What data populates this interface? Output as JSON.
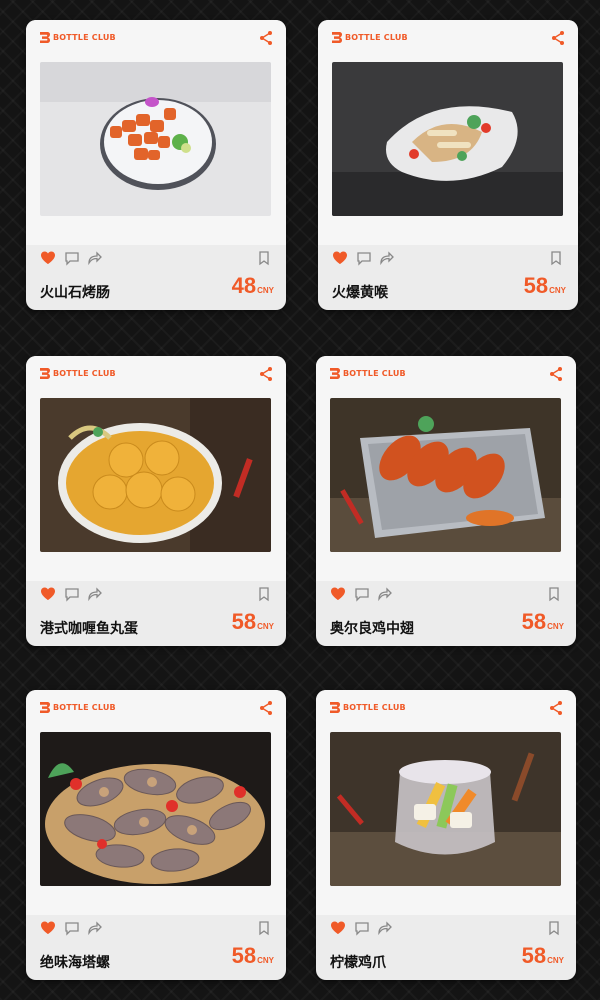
{
  "brand": {
    "name": "BOTTLE CLUB",
    "accent": "#f05a28"
  },
  "currency": "CNY",
  "items": [
    {
      "name": "火山石烤肠",
      "price": "48",
      "currency": "CNY"
    },
    {
      "name": "火爆黄喉",
      "price": "58",
      "currency": "CNY"
    },
    {
      "name": "港式咖喱鱼丸蛋",
      "price": "58",
      "currency": "CNY"
    },
    {
      "name": "奥尔良鸡中翅",
      "price": "58",
      "currency": "CNY"
    },
    {
      "name": "绝味海塔螺",
      "price": "58",
      "currency": "CNY"
    },
    {
      "name": "柠檬鸡爪",
      "price": "58",
      "currency": "CNY"
    }
  ],
  "icons": [
    "share-icon",
    "heart-icon",
    "comment-icon",
    "forward-icon",
    "bookmark-icon"
  ]
}
